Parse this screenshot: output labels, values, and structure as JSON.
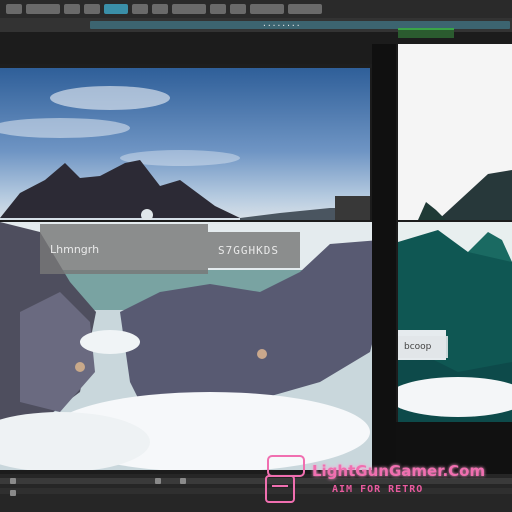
{
  "toolbar": {
    "strip_label": "........"
  },
  "panels": {
    "rock_label": "Lhmngrh",
    "rock_code": "S7GGHKDS",
    "teal_label": "bcoop"
  },
  "watermark": {
    "title": "LightGunGamer.Com",
    "subtitle": "AIM FOR RETRO"
  },
  "colors": {
    "accent": "#3a8fa8",
    "tab_green": "#3aa447",
    "watermark_pink": "#f06fb0"
  }
}
